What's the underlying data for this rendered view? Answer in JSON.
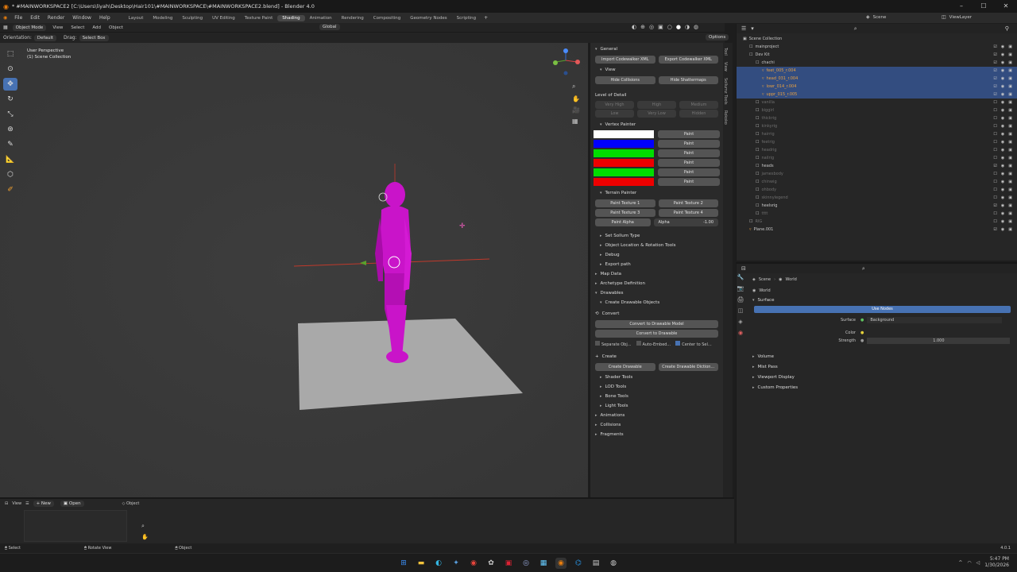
{
  "window": {
    "title": "* #MAINWORKSPACE2 [C:\\Users\\liyah\\Desktop\\Hair101\\#MAINWORKSPACE\\#MAINWORKSPACE2.blend] - Blender 4.0"
  },
  "menubar": {
    "items": [
      "File",
      "Edit",
      "Render",
      "Window",
      "Help"
    ],
    "workspaces": [
      "Layout",
      "Modeling",
      "Sculpting",
      "UV Editing",
      "Texture Paint",
      "Shading",
      "Animation",
      "Rendering",
      "Compositing",
      "Geometry Nodes",
      "Scripting"
    ],
    "active_workspace": "Shading",
    "scene": "Scene",
    "view_layer": "ViewLayer"
  },
  "viewport_header": {
    "mode": "Object Mode",
    "menus": [
      "View",
      "Select",
      "Add",
      "Object"
    ],
    "orientation_label": "Orientation:",
    "orientation": "Default",
    "drag_label": "Drag:",
    "drag": "Select Box",
    "transform": "Global",
    "options": "Options"
  },
  "viewport": {
    "perspective": "User Perspective",
    "collection": "(1) Scene Collection"
  },
  "npanel": {
    "general": "General",
    "import_xml": "Import Codewalker XML",
    "export_xml": "Export Codewalker XML",
    "view": "View",
    "hide_collisions": "Hide Collisions",
    "hide_shattermaps": "Hide Shattermaps",
    "lod_label": "Level of Detail",
    "lod_row1": [
      "Very High",
      "High",
      "Medium"
    ],
    "lod_row2": [
      "Low",
      "Very Low",
      "Hidden"
    ],
    "vertex_painter": "Vertex Painter",
    "paint_label": "Paint",
    "swatches": [
      "#ffffff",
      "#0000ff",
      "#00dd00",
      "#ee0000",
      "#00dd00",
      "#ee0000"
    ],
    "terrain_painter": "Terrain Painter",
    "paint_textures": [
      "Paint Texture 1",
      "Paint Texture 2",
      "Paint Texture 3",
      "Paint Texture 4"
    ],
    "paint_alpha": "Paint Alpha",
    "alpha_label": "Alpha",
    "alpha_value": "-1.00",
    "tools": [
      "Set Sollum Type",
      "Object Location & Rotation Tools",
      "Debug",
      "Export path"
    ],
    "map_data": "Map Data",
    "archetype": "Archetype Definition",
    "drawables": "Drawables",
    "create_drawable_objects": "Create Drawable Objects",
    "convert": "Convert",
    "convert_model": "Convert to Drawable Model",
    "convert_drawable": "Convert to Drawable",
    "separate_obj": "Separate Obj...",
    "auto_embed": "Auto-Embed...",
    "center_to_selection": "Center to Sel...",
    "create": "Create",
    "create_drawable": "Create Drawable",
    "create_drawable_dict": "Create Drawable Diction...",
    "sub_tools": [
      "Shader Tools",
      "LOD Tools",
      "Bone Tools",
      "Light Tools"
    ],
    "animations": "Animations",
    "collisions": "Collisions",
    "fragments": "Fragments",
    "tabs": [
      "Tool",
      "View",
      "Sollumz Tools",
      "Rokoko"
    ]
  },
  "outliner": {
    "rows": [
      {
        "name": "Scene Collection",
        "indent": 0,
        "type": "scene"
      },
      {
        "name": "mainproject",
        "indent": 1,
        "type": "coll"
      },
      {
        "name": "Dev Kit",
        "indent": 1,
        "type": "coll"
      },
      {
        "name": "chachi",
        "indent": 2,
        "type": "coll"
      },
      {
        "name": "feet_005_r.004",
        "indent": 3,
        "type": "mesh",
        "sel": true
      },
      {
        "name": "head_031_r.004",
        "indent": 3,
        "type": "mesh",
        "sel": true
      },
      {
        "name": "lowr_014_r.004",
        "indent": 3,
        "type": "mesh",
        "sel": true
      },
      {
        "name": "uppr_015_r.005",
        "indent": 3,
        "type": "mesh",
        "sel": true
      },
      {
        "name": "vanilla",
        "indent": 2,
        "type": "coll",
        "dim": true
      },
      {
        "name": "biggirl",
        "indent": 2,
        "type": "coll",
        "dim": true
      },
      {
        "name": "thickrig",
        "indent": 2,
        "type": "coll",
        "dim": true
      },
      {
        "name": "kinkyrig",
        "indent": 2,
        "type": "coll",
        "dim": true
      },
      {
        "name": "hairrig",
        "indent": 2,
        "type": "coll",
        "dim": true
      },
      {
        "name": "feetrig",
        "indent": 2,
        "type": "coll",
        "dim": true
      },
      {
        "name": "headrig",
        "indent": 2,
        "type": "coll",
        "dim": true
      },
      {
        "name": "nailrig",
        "indent": 2,
        "type": "coll",
        "dim": true
      },
      {
        "name": "heads",
        "indent": 2,
        "type": "coll"
      },
      {
        "name": "jamesbody",
        "indent": 2,
        "type": "coll",
        "dim": true
      },
      {
        "name": "chinwig",
        "indent": 2,
        "type": "coll",
        "dim": true
      },
      {
        "name": "ohbody",
        "indent": 2,
        "type": "coll",
        "dim": true
      },
      {
        "name": "skinnylegend",
        "indent": 2,
        "type": "coll",
        "dim": true
      },
      {
        "name": "heelsrig",
        "indent": 2,
        "type": "coll"
      },
      {
        "name": "tttt",
        "indent": 2,
        "type": "coll",
        "dim": true
      },
      {
        "name": "RIG",
        "indent": 1,
        "type": "coll",
        "dim": true
      },
      {
        "name": "Plane.001",
        "indent": 1,
        "type": "mesh"
      }
    ]
  },
  "properties": {
    "breadcrumb_scene": "Scene",
    "breadcrumb_world": "World",
    "world_name": "World",
    "surface": "Surface",
    "use_nodes": "Use Nodes",
    "surface_label": "Surface",
    "surface_value": "Background",
    "color_label": "Color",
    "strength_label": "Strength",
    "strength_value": "1.000",
    "panels": [
      "Volume",
      "Mist Pass",
      "Viewport Display",
      "Custom Properties"
    ]
  },
  "timeline": {
    "view": "View",
    "new": "New",
    "open": "Open",
    "object": "Object"
  },
  "statusbar": {
    "select": "Select",
    "rotate": "Rotate View",
    "object": "Object",
    "version": "4.0.1"
  },
  "taskbar": {
    "time": "5:47 PM",
    "date": "1/30/2026"
  }
}
